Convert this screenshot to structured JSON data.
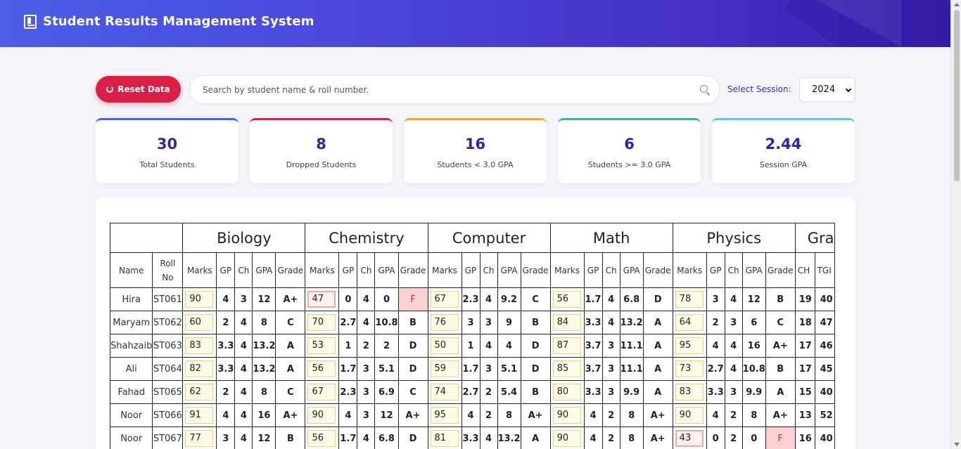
{
  "header": {
    "title": "Student Results Management System"
  },
  "toolbar": {
    "reset_label": "Reset Data",
    "search_placeholder": "Search by student name & roll number.",
    "session_label": "Select Session:",
    "session_value": "2024"
  },
  "stats": [
    {
      "value": "30",
      "label": "Total Students",
      "color": "#4b5ee8"
    },
    {
      "value": "8",
      "label": "Dropped Students",
      "color": "#dc1f45"
    },
    {
      "value": "16",
      "label": "Students < 3.0 GPA",
      "color": "#f5a623"
    },
    {
      "value": "6",
      "label": "Students >= 3.0 GPA",
      "color": "#2fb8a8"
    },
    {
      "value": "2.44",
      "label": "Session GPA",
      "color": "#5bc8e8"
    }
  ],
  "table": {
    "head_name": "Name",
    "head_roll": "Roll No",
    "subjects": [
      "Biology",
      "Chemistry",
      "Computer",
      "Math",
      "Physics"
    ],
    "grand_label": "Gra",
    "sub_headers": [
      "Marks",
      "GP",
      "Ch",
      "GPA",
      "Grade"
    ],
    "grand_sub_headers": [
      "CH",
      "TGI"
    ],
    "rows": [
      {
        "name": "Hira",
        "roll": "ST061",
        "subjects": [
          [
            "90",
            "4",
            "3",
            "12",
            "A+"
          ],
          [
            "47",
            "0",
            "4",
            "0",
            "F"
          ],
          [
            "67",
            "2.3",
            "4",
            "9.2",
            "C"
          ],
          [
            "56",
            "1.7",
            "4",
            "6.8",
            "D"
          ],
          [
            "78",
            "3",
            "4",
            "12",
            "B"
          ]
        ],
        "ch": "19",
        "tgp": "40"
      },
      {
        "name": "Maryam",
        "roll": "ST062",
        "subjects": [
          [
            "60",
            "2",
            "4",
            "8",
            "C"
          ],
          [
            "70",
            "2.7",
            "4",
            "10.8",
            "B"
          ],
          [
            "76",
            "3",
            "3",
            "9",
            "B"
          ],
          [
            "84",
            "3.3",
            "4",
            "13.2",
            "A"
          ],
          [
            "64",
            "2",
            "3",
            "6",
            "C"
          ]
        ],
        "ch": "18",
        "tgp": "47"
      },
      {
        "name": "Shahzaib",
        "roll": "ST063",
        "subjects": [
          [
            "83",
            "3.3",
            "4",
            "13.2",
            "A"
          ],
          [
            "53",
            "1",
            "2",
            "2",
            "D"
          ],
          [
            "50",
            "1",
            "4",
            "4",
            "D"
          ],
          [
            "87",
            "3.7",
            "3",
            "11.1",
            "A"
          ],
          [
            "95",
            "4",
            "4",
            "16",
            "A+"
          ]
        ],
        "ch": "17",
        "tgp": "46"
      },
      {
        "name": "Ali",
        "roll": "ST064",
        "subjects": [
          [
            "82",
            "3.3",
            "4",
            "13.2",
            "A"
          ],
          [
            "56",
            "1.7",
            "3",
            "5.1",
            "D"
          ],
          [
            "59",
            "1.7",
            "3",
            "5.1",
            "D"
          ],
          [
            "85",
            "3.7",
            "3",
            "11.1",
            "A"
          ],
          [
            "73",
            "2.7",
            "4",
            "10.8",
            "B"
          ]
        ],
        "ch": "17",
        "tgp": "45"
      },
      {
        "name": "Fahad",
        "roll": "ST065",
        "subjects": [
          [
            "62",
            "2",
            "4",
            "8",
            "C"
          ],
          [
            "67",
            "2.3",
            "3",
            "6.9",
            "C"
          ],
          [
            "74",
            "2.7",
            "2",
            "5.4",
            "B"
          ],
          [
            "80",
            "3.3",
            "3",
            "9.9",
            "A"
          ],
          [
            "83",
            "3.3",
            "3",
            "9.9",
            "A"
          ]
        ],
        "ch": "15",
        "tgp": "40"
      },
      {
        "name": "Noor",
        "roll": "ST066",
        "subjects": [
          [
            "91",
            "4",
            "4",
            "16",
            "A+"
          ],
          [
            "90",
            "4",
            "3",
            "12",
            "A+"
          ],
          [
            "95",
            "4",
            "2",
            "8",
            "A+"
          ],
          [
            "90",
            "4",
            "2",
            "8",
            "A+"
          ],
          [
            "90",
            "4",
            "2",
            "8",
            "A+"
          ]
        ],
        "ch": "13",
        "tgp": "52"
      },
      {
        "name": "Noor",
        "roll": "ST067",
        "subjects": [
          [
            "77",
            "3",
            "4",
            "12",
            "B"
          ],
          [
            "56",
            "1.7",
            "4",
            "6.8",
            "D"
          ],
          [
            "81",
            "3.3",
            "4",
            "13.2",
            "A"
          ],
          [
            "90",
            "4",
            "2",
            "8",
            "A+"
          ],
          [
            "43",
            "0",
            "2",
            "0",
            "F"
          ]
        ],
        "ch": "16",
        "tgp": "40"
      }
    ]
  }
}
